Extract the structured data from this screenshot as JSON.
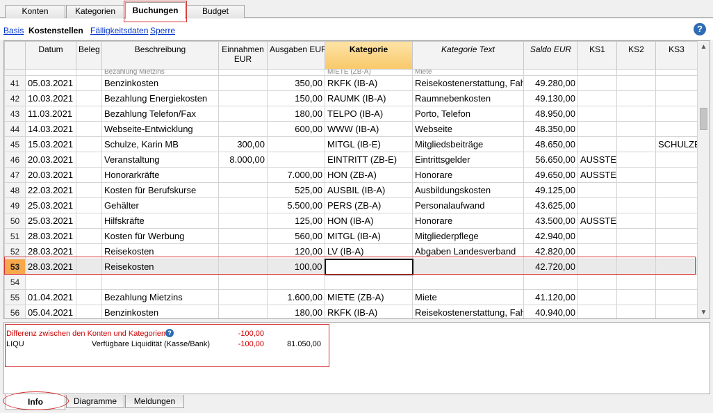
{
  "tabs_top": [
    "Konten",
    "Kategorien",
    "Buchungen",
    "Budget"
  ],
  "subnav": {
    "basis": "Basis",
    "kostenstellen": "Kostenstellen",
    "faelligkeit": "Fälligkeitsdaten",
    "sperre": "Sperre",
    "help": "?"
  },
  "columns": {
    "datum": "Datum",
    "beleg": "Beleg",
    "beschreibung": "Beschreibung",
    "einnahmen": "Einnahmen EUR",
    "ausgaben": "Ausgaben EUR",
    "kategorie": "Kategorie",
    "kattext": "Kategorie Text",
    "saldo": "Saldo EUR",
    "ks1": "KS1",
    "ks2": "KS2",
    "ks3": "KS3"
  },
  "partial_row": {
    "beschreibung": "Bezahlung Mietzins",
    "kategorie": "MIETE (ZB-A)",
    "kattext": "Miete"
  },
  "rows": [
    {
      "nr": "41",
      "datum": "05.03.2021",
      "beschr": "Benzinkosten",
      "ein": "",
      "aus": "350,00",
      "kat": "RKFK (IB-A)",
      "kattext": "Reisekostenerstattung, Fah",
      "saldo": "49.280,00",
      "ks1": "",
      "ks3": ""
    },
    {
      "nr": "42",
      "datum": "10.03.2021",
      "beschr": "Bezahlung Energiekosten",
      "ein": "",
      "aus": "150,00",
      "kat": "RAUMK (IB-A)",
      "kattext": "Raumnebenkosten",
      "saldo": "49.130,00",
      "ks1": "",
      "ks3": ""
    },
    {
      "nr": "43",
      "datum": "11.03.2021",
      "beschr": "Bezahlung Telefon/Fax",
      "ein": "",
      "aus": "180,00",
      "kat": "TELPO (IB-A)",
      "kattext": "Porto, Telefon",
      "saldo": "48.950,00",
      "ks1": "",
      "ks3": ""
    },
    {
      "nr": "44",
      "datum": "14.03.2021",
      "beschr": "Webseite-Entwicklung",
      "ein": "",
      "aus": "600,00",
      "kat": "WWW (IB-A)",
      "kattext": "Webseite",
      "saldo": "48.350,00",
      "ks1": "",
      "ks3": ""
    },
    {
      "nr": "45",
      "datum": "15.03.2021",
      "beschr": "Schulze, Karin MB",
      "ein": "300,00",
      "aus": "",
      "kat": "MITGL (IB-E)",
      "kattext": "Mitgliedsbeiträge",
      "saldo": "48.650,00",
      "ks1": "",
      "ks3": "SCHULZE"
    },
    {
      "nr": "46",
      "datum": "20.03.2021",
      "beschr": "Veranstaltung",
      "ein": "8.000,00",
      "aus": "",
      "kat": "EINTRITT (ZB-E)",
      "kattext": "Eintrittsgelder",
      "saldo": "56.650,00",
      "ks1": "AUSSTE",
      "ks3": ""
    },
    {
      "nr": "47",
      "datum": "20.03.2021",
      "beschr": "Honorarkräfte",
      "ein": "",
      "aus": "7.000,00",
      "kat": "HON (ZB-A)",
      "kattext": "Honorare",
      "saldo": "49.650,00",
      "ks1": "AUSSTE",
      "ks3": ""
    },
    {
      "nr": "48",
      "datum": "22.03.2021",
      "beschr": "Kosten für Berufskurse",
      "ein": "",
      "aus": "525,00",
      "kat": "AUSBIL (IB-A)",
      "kattext": "Ausbildungskosten",
      "saldo": "49.125,00",
      "ks1": "",
      "ks3": ""
    },
    {
      "nr": "49",
      "datum": "25.03.2021",
      "beschr": "Gehälter",
      "ein": "",
      "aus": "5.500,00",
      "kat": "PERS (ZB-A)",
      "kattext": "Personalaufwand",
      "saldo": "43.625,00",
      "ks1": "",
      "ks3": ""
    },
    {
      "nr": "50",
      "datum": "25.03.2021",
      "beschr": "Hilfskräfte",
      "ein": "",
      "aus": "125,00",
      "kat": "HON (IB-A)",
      "kattext": "Honorare",
      "saldo": "43.500,00",
      "ks1": "AUSSTE",
      "ks3": ""
    },
    {
      "nr": "51",
      "datum": "28.03.2021",
      "beschr": "Kosten für Werbung",
      "ein": "",
      "aus": "560,00",
      "kat": "MITGL (IB-A)",
      "kattext": "Mitgliederpflege",
      "saldo": "42.940,00",
      "ks1": "",
      "ks3": ""
    },
    {
      "nr": "52",
      "datum": "28.03.2021",
      "beschr": "Reisekosten",
      "ein": "",
      "aus": "120,00",
      "kat": "LV (IB-A)",
      "kattext": "Abgaben Landesverband",
      "saldo": "42.820,00",
      "ks1": "",
      "ks3": ""
    },
    {
      "nr": "53",
      "datum": "28.03.2021",
      "beschr": "Reisekosten",
      "ein": "",
      "aus": "100,00",
      "kat": "",
      "kattext": "",
      "saldo": "42.720,00",
      "ks1": "",
      "ks3": ""
    },
    {
      "nr": "54",
      "datum": "",
      "beschr": "",
      "ein": "",
      "aus": "",
      "kat": "",
      "kattext": "",
      "saldo": "",
      "ks1": "",
      "ks3": ""
    },
    {
      "nr": "55",
      "datum": "01.04.2021",
      "beschr": "Bezahlung Mietzins",
      "ein": "",
      "aus": "1.600,00",
      "kat": "MIETE (ZB-A)",
      "kattext": "Miete",
      "saldo": "41.120,00",
      "ks1": "",
      "ks3": ""
    },
    {
      "nr": "56",
      "datum": "05.04.2021",
      "beschr": "Benzinkosten",
      "ein": "",
      "aus": "180,00",
      "kat": "RKFK (IB-A)",
      "kattext": "Reisekostenerstattung, Fah",
      "saldo": "40.940,00",
      "ks1": "",
      "ks3": ""
    }
  ],
  "info": {
    "diff_label": "Differenz zwischen den Konten und Kategorien",
    "diff_value": "-100,00",
    "account": "LIQU",
    "account_desc": "Verfügbare Liquidität (Kasse/Bank)",
    "account_diff": "-100,00",
    "account_balance": "81.050,00"
  },
  "tabs_bottom": [
    "Info",
    "Diagramme",
    "Meldungen"
  ]
}
